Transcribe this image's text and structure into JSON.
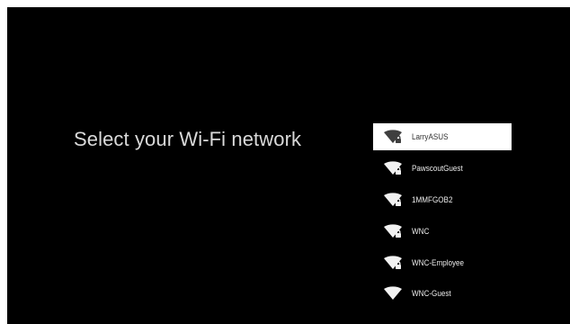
{
  "page": {
    "title": "Select your Wi-Fi network"
  },
  "colors": {
    "background": "#000000",
    "title_text": "#d9d9d9",
    "selected_item_background": "#ffffff",
    "selected_item_text": "#333333",
    "item_text": "#ececec"
  },
  "networks": [
    {
      "name": "LarryASUS",
      "secured": true,
      "selected": true,
      "icon": "wifi-lock-icon"
    },
    {
      "name": "PawscoutGuest",
      "secured": true,
      "selected": false,
      "icon": "wifi-lock-icon"
    },
    {
      "name": "1MMFGOB2",
      "secured": true,
      "selected": false,
      "icon": "wifi-lock-icon"
    },
    {
      "name": "WNC",
      "secured": true,
      "selected": false,
      "icon": "wifi-lock-icon"
    },
    {
      "name": "WNC-Employee",
      "secured": true,
      "selected": false,
      "icon": "wifi-lock-icon"
    },
    {
      "name": "WNC-Guest",
      "secured": false,
      "selected": false,
      "icon": "wifi-icon"
    }
  ]
}
